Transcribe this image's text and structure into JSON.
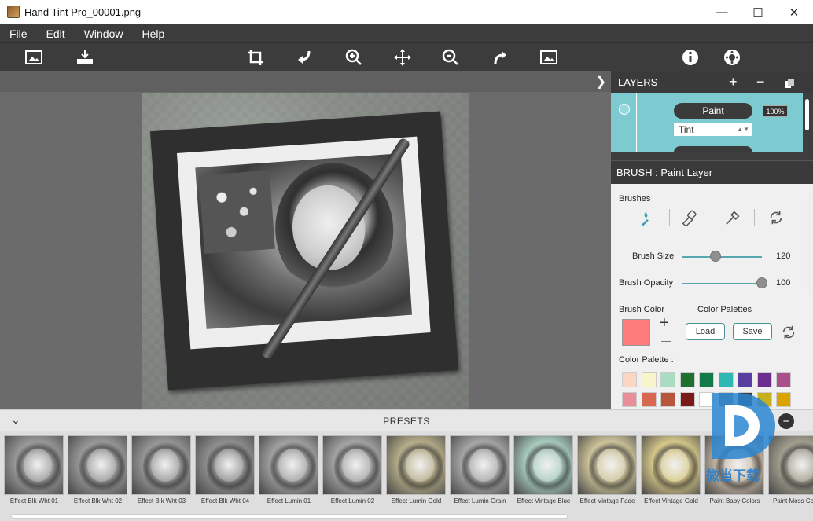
{
  "window": {
    "title": "Hand Tint Pro_00001.png",
    "minimize": "—",
    "maximize": "☐",
    "close": "✕"
  },
  "menu": [
    "File",
    "Edit",
    "Window",
    "Help"
  ],
  "layers": {
    "header": "LAYERS",
    "add": "+",
    "remove": "−",
    "layer_name": "Paint",
    "layer_opacity": "100%",
    "layer_mode": "Tint"
  },
  "brush": {
    "header": "BRUSH : Paint Layer",
    "brushes_label": "Brushes",
    "size_label": "Brush Size",
    "size_value": "120",
    "size_fraction": 0.42,
    "opacity_label": "Brush Opacity",
    "opacity_value": "100",
    "opacity_fraction": 1.0,
    "color_label": "Brush Color",
    "color": "#ff7c7c",
    "palettes_label": "Color Palettes",
    "load_label": "Load",
    "save_label": "Save",
    "palette_label": "Color Palette :",
    "palette_row1": [
      "#f9d7c4",
      "#f8f4cc",
      "#a9dcc0",
      "#1f6f2e",
      "#157a4a",
      "#2fb7b1",
      "#5a3da0",
      "#6b2d8e",
      "#a8508a"
    ],
    "palette_row2": [
      "#e98f9a",
      "#d8684f",
      "#b8563d",
      "#7a1a1a",
      "#ffffff",
      "#7a7a7a",
      "#3b3b3b",
      "#c7b01c",
      "#d9a400"
    ]
  },
  "presets": {
    "title": "PRESETS",
    "add": "+",
    "remove": "−",
    "items": [
      {
        "label": "Effect Blk Wht 01",
        "tint": "#9a9a9a"
      },
      {
        "label": "Effect Blk Wht 02",
        "tint": "#999999"
      },
      {
        "label": "Effect Blk Wht 03",
        "tint": "#979797"
      },
      {
        "label": "Effect Blk Wht 04",
        "tint": "#8f8f8f"
      },
      {
        "label": "Effect Lumin 01",
        "tint": "#a2a2a2"
      },
      {
        "label": "Effect Lumin 02",
        "tint": "#a5a5a5"
      },
      {
        "label": "Effect Lumin Gold",
        "tint": "#b7ae8a"
      },
      {
        "label": "Effect Lumin Grain",
        "tint": "#a8a8a8"
      },
      {
        "label": "Effect Vintage Blue",
        "tint": "#a9cdbf"
      },
      {
        "label": "Effect Vintage Fade",
        "tint": "#cfc59a"
      },
      {
        "label": "Effect Vintage Gold",
        "tint": "#d8c98a"
      },
      {
        "label": "Paint Baby Colors",
        "tint": "#c9b9a6"
      },
      {
        "label": "Paint Moss Colors",
        "tint": "#a3a08f"
      }
    ]
  },
  "watermark": "微当下载"
}
